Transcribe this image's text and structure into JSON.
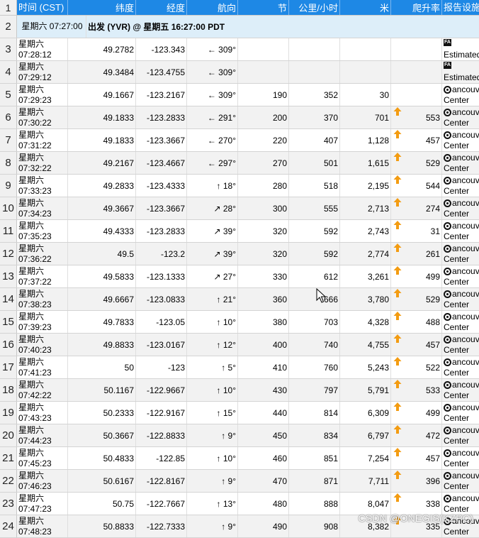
{
  "header": {
    "row_number": "1",
    "columns": [
      "时间 (CST)",
      "纬度",
      "经度",
      "航向",
      "节",
      "公里/小时",
      "米",
      "爬升率",
      "报告设施"
    ]
  },
  "departure_row": {
    "row_number": "2",
    "time": "星期六 07:27:00",
    "text": "出发 (YVR) @ 星期五 16:27:00 PDT"
  },
  "rows": [
    {
      "n": "3",
      "day": "星期六",
      "time": "07:28:12",
      "lat": "49.2782",
      "lon": "-123.343",
      "hdg": "← 309°",
      "kt": "",
      "kmh": "",
      "m": "",
      "climb": "",
      "up": false,
      "fac_type": "fa",
      "fac1": "",
      "fac2": "Estimated"
    },
    {
      "n": "4",
      "day": "星期六",
      "time": "07:29:12",
      "lat": "49.3484",
      "lon": "-123.4755",
      "hdg": "← 309°",
      "kt": "",
      "kmh": "",
      "m": "",
      "climb": "",
      "up": false,
      "fac_type": "fa",
      "fac1": "",
      "fac2": "Estimated"
    },
    {
      "n": "5",
      "day": "星期六",
      "time": "07:29:23",
      "lat": "49.1667",
      "lon": "-123.2167",
      "hdg": "← 309°",
      "kt": "190",
      "kmh": "352",
      "m": "30",
      "climb": "",
      "up": false,
      "fac_type": "center",
      "fac1": "ancouver",
      "fac2": "Center"
    },
    {
      "n": "6",
      "day": "星期六",
      "time": "07:30:22",
      "lat": "49.1833",
      "lon": "-123.2833",
      "hdg": "← 291°",
      "kt": "200",
      "kmh": "370",
      "m": "701",
      "climb": "553",
      "up": true,
      "fac_type": "center",
      "fac1": "ancouver",
      "fac2": "Center"
    },
    {
      "n": "7",
      "day": "星期六",
      "time": "07:31:22",
      "lat": "49.1833",
      "lon": "-123.3667",
      "hdg": "← 270°",
      "kt": "220",
      "kmh": "407",
      "m": "1,128",
      "climb": "457",
      "up": true,
      "fac_type": "center",
      "fac1": "ancouver",
      "fac2": "Center"
    },
    {
      "n": "8",
      "day": "星期六",
      "time": "07:32:22",
      "lat": "49.2167",
      "lon": "-123.4667",
      "hdg": "← 297°",
      "kt": "270",
      "kmh": "501",
      "m": "1,615",
      "climb": "529",
      "up": true,
      "fac_type": "center",
      "fac1": "ancouver",
      "fac2": "Center"
    },
    {
      "n": "9",
      "day": "星期六",
      "time": "07:33:23",
      "lat": "49.2833",
      "lon": "-123.4333",
      "hdg": "↑ 18°",
      "kt": "280",
      "kmh": "518",
      "m": "2,195",
      "climb": "544",
      "up": true,
      "fac_type": "center",
      "fac1": "ancouver",
      "fac2": "Center"
    },
    {
      "n": "10",
      "day": "星期六",
      "time": "07:34:23",
      "lat": "49.3667",
      "lon": "-123.3667",
      "hdg": "↗ 28°",
      "kt": "300",
      "kmh": "555",
      "m": "2,713",
      "climb": "274",
      "up": true,
      "fac_type": "center",
      "fac1": "ancouver",
      "fac2": "Center"
    },
    {
      "n": "11",
      "day": "星期六",
      "time": "07:35:23",
      "lat": "49.4333",
      "lon": "-123.2833",
      "hdg": "↗ 39°",
      "kt": "320",
      "kmh": "592",
      "m": "2,743",
      "climb": "31",
      "up": true,
      "fac_type": "center",
      "fac1": "ancouver",
      "fac2": "Center"
    },
    {
      "n": "12",
      "day": "星期六",
      "time": "07:36:22",
      "lat": "49.5",
      "lon": "-123.2",
      "hdg": "↗ 39°",
      "kt": "320",
      "kmh": "592",
      "m": "2,774",
      "climb": "261",
      "up": true,
      "fac_type": "center",
      "fac1": "ancouver",
      "fac2": "Center"
    },
    {
      "n": "13",
      "day": "星期六",
      "time": "07:37:22",
      "lat": "49.5833",
      "lon": "-123.1333",
      "hdg": "↗ 27°",
      "kt": "330",
      "kmh": "612",
      "m": "3,261",
      "climb": "499",
      "up": true,
      "fac_type": "center",
      "fac1": "ancouver",
      "fac2": "Center"
    },
    {
      "n": "14",
      "day": "星期六",
      "time": "07:38:23",
      "lat": "49.6667",
      "lon": "-123.0833",
      "hdg": "↑ 21°",
      "kt": "360",
      "kmh": "666",
      "m": "3,780",
      "climb": "529",
      "up": true,
      "fac_type": "center",
      "fac1": "ancouver",
      "fac2": "Center"
    },
    {
      "n": "15",
      "day": "星期六",
      "time": "07:39:23",
      "lat": "49.7833",
      "lon": "-123.05",
      "hdg": "↑ 10°",
      "kt": "380",
      "kmh": "703",
      "m": "4,328",
      "climb": "488",
      "up": true,
      "fac_type": "center",
      "fac1": "ancouver",
      "fac2": "Center"
    },
    {
      "n": "16",
      "day": "星期六",
      "time": "07:40:23",
      "lat": "49.8833",
      "lon": "-123.0167",
      "hdg": "↑ 12°",
      "kt": "400",
      "kmh": "740",
      "m": "4,755",
      "climb": "457",
      "up": true,
      "fac_type": "center",
      "fac1": "ancouver",
      "fac2": "Center"
    },
    {
      "n": "17",
      "day": "星期六",
      "time": "07:41:23",
      "lat": "50",
      "lon": "-123",
      "hdg": "↑ 5°",
      "kt": "410",
      "kmh": "760",
      "m": "5,243",
      "climb": "522",
      "up": true,
      "fac_type": "center",
      "fac1": "ancouver",
      "fac2": "Center"
    },
    {
      "n": "18",
      "day": "星期六",
      "time": "07:42:22",
      "lat": "50.1167",
      "lon": "-122.9667",
      "hdg": "↑ 10°",
      "kt": "430",
      "kmh": "797",
      "m": "5,791",
      "climb": "533",
      "up": true,
      "fac_type": "center",
      "fac1": "ancouver",
      "fac2": "Center"
    },
    {
      "n": "19",
      "day": "星期六",
      "time": "07:43:23",
      "lat": "50.2333",
      "lon": "-122.9167",
      "hdg": "↑ 15°",
      "kt": "440",
      "kmh": "814",
      "m": "6,309",
      "climb": "499",
      "up": true,
      "fac_type": "center",
      "fac1": "ancouver",
      "fac2": "Center"
    },
    {
      "n": "20",
      "day": "星期六",
      "time": "07:44:23",
      "lat": "50.3667",
      "lon": "-122.8833",
      "hdg": "↑ 9°",
      "kt": "450",
      "kmh": "834",
      "m": "6,797",
      "climb": "472",
      "up": true,
      "fac_type": "center",
      "fac1": "ancouver",
      "fac2": "Center"
    },
    {
      "n": "21",
      "day": "星期六",
      "time": "07:45:23",
      "lat": "50.4833",
      "lon": "-122.85",
      "hdg": "↑ 10°",
      "kt": "460",
      "kmh": "851",
      "m": "7,254",
      "climb": "457",
      "up": true,
      "fac_type": "center",
      "fac1": "ancouver",
      "fac2": "Center"
    },
    {
      "n": "22",
      "day": "星期六",
      "time": "07:46:23",
      "lat": "50.6167",
      "lon": "-122.8167",
      "hdg": "↑ 9°",
      "kt": "470",
      "kmh": "871",
      "m": "7,711",
      "climb": "396",
      "up": true,
      "fac_type": "center",
      "fac1": "ancouver",
      "fac2": "Center"
    },
    {
      "n": "23",
      "day": "星期六",
      "time": "07:47:23",
      "lat": "50.75",
      "lon": "-122.7667",
      "hdg": "↑ 13°",
      "kt": "480",
      "kmh": "888",
      "m": "8,047",
      "climb": "338",
      "up": true,
      "fac_type": "center",
      "fac1": "ancouver",
      "fac2": "Center"
    },
    {
      "n": "24",
      "day": "星期六",
      "time": "07:48:23",
      "lat": "50.8833",
      "lon": "-122.7333",
      "hdg": "↑ 9°",
      "kt": "490",
      "kmh": "908",
      "m": "8,382",
      "climb": "335",
      "up": true,
      "fac_type": "center",
      "fac1": "ancouver",
      "fac2": "Center"
    }
  ],
  "watermark": "CSDN @ONEGIS(KZPC)",
  "colors": {
    "header_bg": "#1e88e5",
    "departure_bg": "#ddeef9",
    "alt_row_bg": "#f2f2f2",
    "climb_arrow": "#f39c12"
  }
}
